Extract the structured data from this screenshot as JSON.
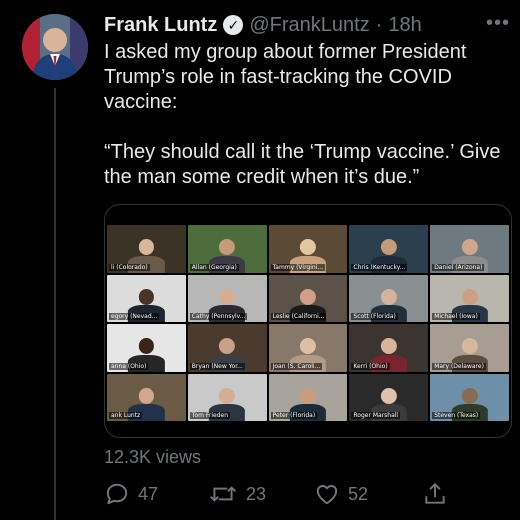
{
  "tweet": {
    "author_name": "Frank Luntz",
    "handle": "@FrankLuntz",
    "separator": "·",
    "time": "18h",
    "more": "•••",
    "text": "I asked my group about former President Trump’s role in fast-tracking the COVID vaccine:\n\n“They should call it the ‘Trump vaccine.’ Give the man some credit when it’s due.”",
    "views": "12.3K views",
    "replies": "47",
    "retweets": "23",
    "likes": "52"
  },
  "media": {
    "participants": [
      {
        "label": "li (Colorado)",
        "bg": "#3a3326",
        "head": "#d8b79a",
        "body": "#6b5a4a"
      },
      {
        "label": "Allan (Georgia)",
        "bg": "#4d6e3c",
        "head": "#c99a7a",
        "body": "#3b3b46"
      },
      {
        "label": "Tammy (Virgini...",
        "bg": "#5a4a36",
        "head": "#e3c7a0",
        "body": "#c8a27a"
      },
      {
        "label": "Chris (Kentucky...",
        "bg": "#2c3f4e",
        "head": "#c49b7b",
        "body": "#1e2b3a"
      },
      {
        "label": "Daniel (Arizona)",
        "bg": "#6f7a80",
        "head": "#d0a68a",
        "body": "#8c8c8c"
      },
      {
        "label": "egory (Nevad...",
        "bg": "#dcdcdc",
        "head": "#4a3326",
        "body": "#1d2530"
      },
      {
        "label": "Cathy (Pennsylv...",
        "bg": "#b7b7b7",
        "head": "#d5ae92",
        "body": "#2c2c30"
      },
      {
        "label": "Leslie (Californi...",
        "bg": "#5d5249",
        "head": "#cfa084",
        "body": "#1a1a1a"
      },
      {
        "label": "Scott (Florida)",
        "bg": "#8a8f92",
        "head": "#d4b39c",
        "body": "#22303d"
      },
      {
        "label": "Michael (Iowa)",
        "bg": "#b9b6ae",
        "head": "#caa185",
        "body": "#283846"
      },
      {
        "label": "anna (Ohio)",
        "bg": "#e6e6e6",
        "head": "#3b2519",
        "body": "#262626"
      },
      {
        "label": "Bryan (New Yor...",
        "bg": "#4b3a2e",
        "head": "#c9a186",
        "body": "#3a3f46"
      },
      {
        "label": "Joan (S. Caroli...",
        "bg": "#87786a",
        "head": "#ddbfa6",
        "body": "#b49a86"
      },
      {
        "label": "Kerri (Ohio)",
        "bg": "#3c3430",
        "head": "#d9b49a",
        "body": "#7a2430"
      },
      {
        "label": "Mary (Delaware)",
        "bg": "#a79d92",
        "head": "#d7b79c",
        "body": "#5b4d40"
      },
      {
        "label": "ank Luntz",
        "bg": "#6b5a44",
        "head": "#d1a88d",
        "body": "#22324a"
      },
      {
        "label": "Tom Frieden",
        "bg": "#c9c9c9",
        "head": "#d3ae94",
        "body": "#2b3440"
      },
      {
        "label": "Peter (Florida)",
        "bg": "#a9a49b",
        "head": "#c99c7e",
        "body": "#1c2a3a"
      },
      {
        "label": "Roger Marshall",
        "bg": "#2a2a2a",
        "head": "#e0c2aa",
        "body": "#3b3b3b"
      },
      {
        "label": "Steven (Texas)",
        "bg": "#6d8fa8",
        "head": "#8a6a55",
        "body": "#2f3b2a"
      }
    ]
  },
  "icons": {
    "reply": "reply-icon",
    "retweet": "retweet-icon",
    "like": "like-icon",
    "share": "share-icon",
    "verified": "verified-icon"
  }
}
